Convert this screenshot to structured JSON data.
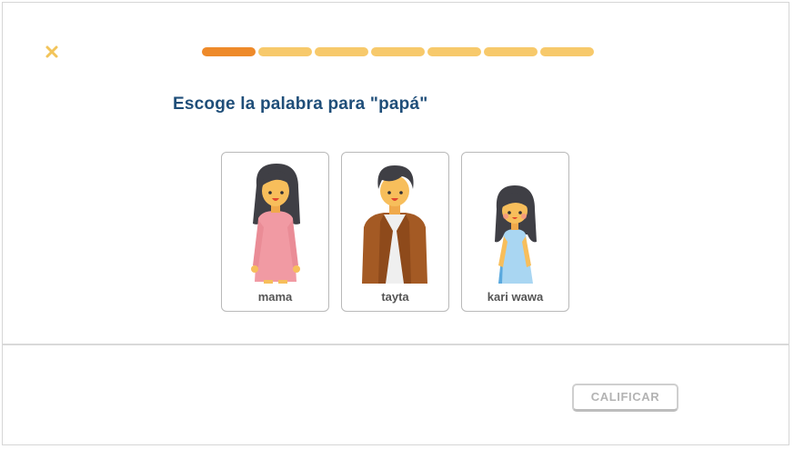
{
  "header": {
    "close_icon": "close-x-icon",
    "progress": {
      "total_steps": 7,
      "completed_steps": 1
    }
  },
  "question": {
    "prompt": "Escoge la palabra para \"papá\""
  },
  "options": [
    {
      "label": "mama",
      "icon": "woman-figure"
    },
    {
      "label": "tayta",
      "icon": "man-figure"
    },
    {
      "label": "kari wawa",
      "icon": "girl-figure"
    }
  ],
  "footer": {
    "check_label": "CALIFICAR"
  },
  "colors": {
    "accent_orange": "#ee8a2a",
    "progress_pending": "#f7c96b",
    "prompt_text": "#1f4e79",
    "close_icon": "#f2c45a"
  }
}
